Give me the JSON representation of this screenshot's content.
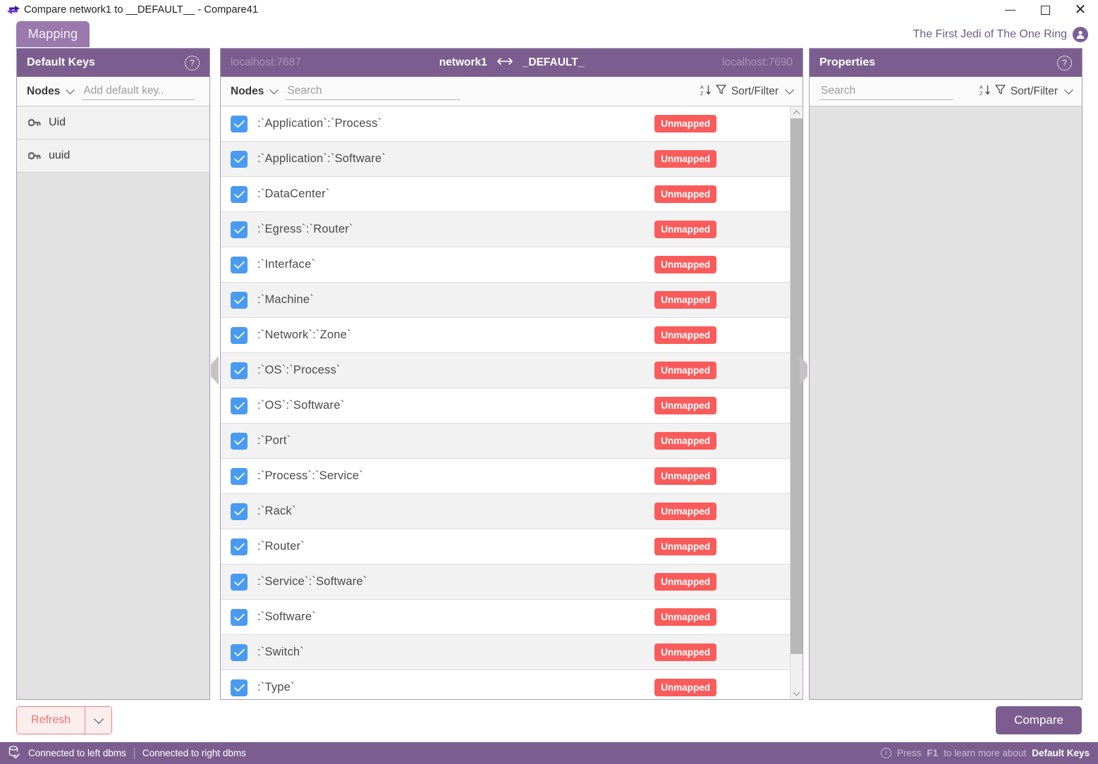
{
  "window": {
    "title": "Compare network1 to __DEFAULT__ - Compare41",
    "app_icon": "compare-arrows-icon",
    "minimize_label": "Minimize",
    "maximize_label": "Maximize",
    "close_label": "Close"
  },
  "tabs": [
    {
      "label": "Mapping",
      "active": true
    }
  ],
  "user": {
    "name": "The First Jedi of The One Ring",
    "avatar_icon": "user-avatar-icon"
  },
  "left_panel": {
    "title": "Default Keys",
    "help_label": "?",
    "dropdown": {
      "label": "Nodes"
    },
    "input": {
      "placeholder": "Add default key..",
      "value": ""
    },
    "keys": [
      {
        "label": "Uid",
        "icon": "key-icon"
      },
      {
        "label": "uuid",
        "icon": "key-icon"
      }
    ]
  },
  "middle_panel": {
    "left_host": "localhost:7687",
    "right_host": "localhost:7690",
    "left_db": "network1",
    "right_db": "_DEFAULT_",
    "link_icon": "left-right-arrow-icon",
    "dropdown": {
      "label": "Nodes"
    },
    "search": {
      "placeholder": "Search",
      "value": ""
    },
    "sort_filter": {
      "label": "Sort/Filter",
      "sort_icon": "sort-az-icon",
      "filter_icon": "funnel-icon"
    },
    "badge_label": "Unmapped",
    "rows": [
      ":`Application`:`Process`",
      ":`Application`:`Software`",
      ":`DataCenter`",
      ":`Egress`:`Router`",
      ":`Interface`",
      ":`Machine`",
      ":`Network`:`Zone`",
      ":`OS`:`Process`",
      ":`OS`:`Software`",
      ":`Port`",
      ":`Process`:`Service`",
      ":`Rack`",
      ":`Router`",
      ":`Service`:`Software`",
      ":`Software`",
      ":`Switch`",
      ":`Type`"
    ]
  },
  "right_panel": {
    "title": "Properties",
    "help_label": "?",
    "search": {
      "placeholder": "Search",
      "value": ""
    },
    "sort_filter": {
      "label": "Sort/Filter",
      "sort_icon": "sort-az-icon",
      "filter_icon": "funnel-icon"
    }
  },
  "footer": {
    "refresh_label": "Refresh",
    "refresh_caret_icon": "chevron-down-icon",
    "compare_label": "Compare"
  },
  "status_bar": {
    "db_icon": "database-check-icon",
    "left_connection": "Connected to left dbms",
    "right_connection": "Connected to right dbms",
    "info_icon": "info-icon",
    "hint_prefix": "Press",
    "hint_key": "F1",
    "hint_middle": "to learn more about",
    "hint_topic": "Default Keys"
  },
  "colors": {
    "purple_header": "#7b5e8f",
    "purple_tab": "#9a79ad",
    "checkbox_blue": "#4a9bf0",
    "badge_red": "#fa5c5c",
    "refresh_red": "#f07070"
  }
}
